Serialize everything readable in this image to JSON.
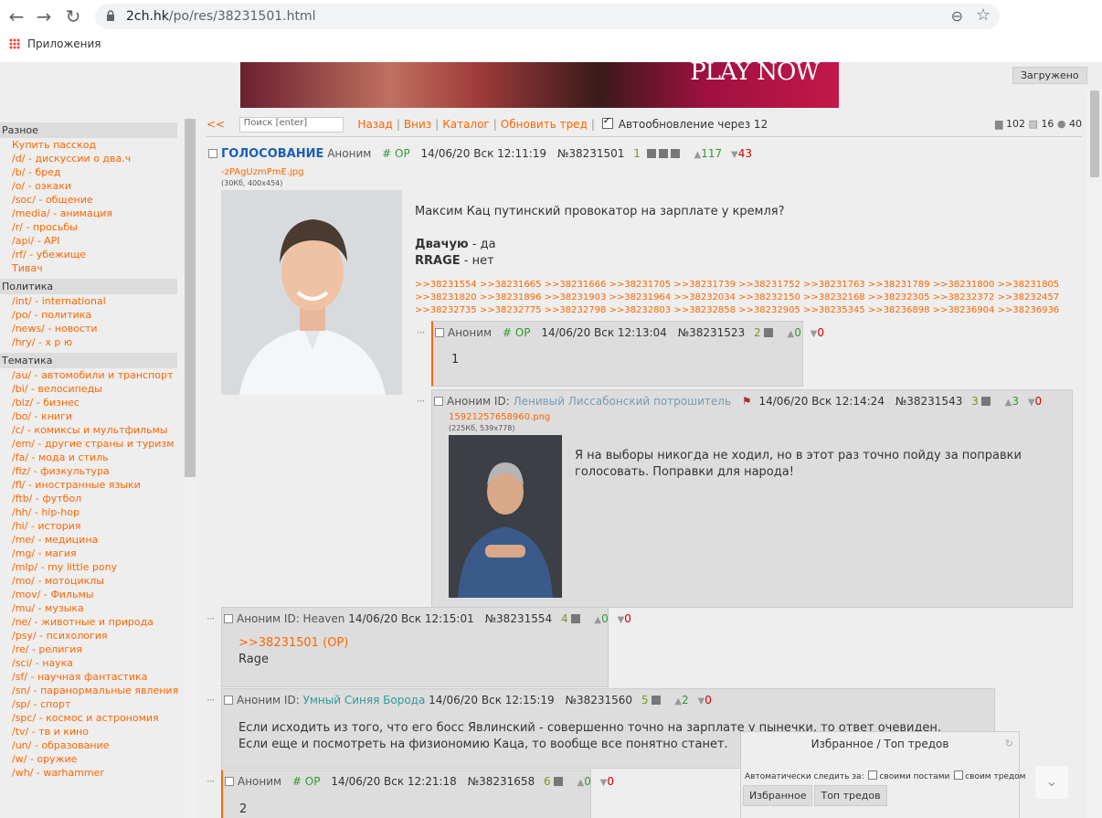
{
  "browser": {
    "url_host": "2ch.hk",
    "url_path": "/po/res/38231501.html",
    "bookmarks_label": "Приложения"
  },
  "page": {
    "banner_text": "PLAY NOW",
    "loaded_label": "Загружено"
  },
  "menu": {
    "sections": [
      {
        "title": "Разное",
        "items": [
          "Купить пасскод",
          "/d/  - дискуссии о два.ч",
          "/b/  - бред",
          "/o/  - оэкаки",
          "/soc/  - общение",
          "/media/  - анимация",
          "/r/  - просьбы",
          "/api/  - API",
          "/rf/  - убежище",
          "Тивач"
        ]
      },
      {
        "title": "Политика",
        "items": [
          "/int/  - international",
          "/po/  - политика",
          "/news/  - новости",
          "/hry/  - х р ю"
        ]
      },
      {
        "title": "Тематика",
        "items": [
          "/au/  - автомобили и транспорт",
          "/bi/  - велосипеды",
          "/biz/  - бизнес",
          "/bo/  - книги",
          "/c/  - комиксы и мультфильмы",
          "/em/  - другие страны и туризм",
          "/fa/  - мода и стиль",
          "/fiz/  - физкультура",
          "/fl/  - иностранные языки",
          "/ftb/  - футбол",
          "/hh/  - hip-hop",
          "/hi/  - история",
          "/me/  - медицина",
          "/mg/  - магия",
          "/mlp/  - my little pony",
          "/mo/  - мотоциклы",
          "/mov/  - Фильмы",
          "/mu/  - музыка",
          "/ne/  - животные и природа",
          "/psy/  - психология",
          "/re/  - религия",
          "/sci/  - наука",
          "/sf/  - научная фантастика",
          "/sn/  - паранормальные явления",
          "/sp/  - спорт",
          "/spc/  - космос и астрономия",
          "/tv/  - тв и кино",
          "/un/  - образование",
          "/w/  - оружие",
          "/wh/  - warhammer"
        ]
      }
    ]
  },
  "topbar": {
    "back": "<<",
    "search_placeholder": "Поиск [enter]",
    "nav_back": "Назад",
    "nav_down": "Вниз",
    "catalog": "Каталог",
    "refresh": "Обновить тред",
    "autoupdate": "Автообновление через 12",
    "stat_posts": "102",
    "stat_images": "16",
    "stat_users": "40"
  },
  "op": {
    "subject": "ГОЛОСОВАНИЕ",
    "name": "Аноним",
    "op_tag": "# OP",
    "date": "14/06/20 Вск 12:11:19",
    "num": "№38231501",
    "count": "1",
    "likes": "117",
    "dislikes": "43",
    "file_name": "-zPAgUzmPmE.jpg",
    "file_meta": "(30Кб, 400x454)",
    "text1": "Максим Кац путинский провокатор на зарплате у кремля?",
    "bold1": "Двачую",
    "text2": " - да",
    "bold2": "RRAGE",
    "text3": " - нет",
    "replies": ">>38231554 >>38231665 >>38231666 >>38231705 >>38231739 >>38231752 >>38231763 >>38231789 >>38231800 >>38231805 >>38231820 >>38231896 >>38231903 >>38231964 >>38232034 >>38232150 >>38232168 >>38232305 >>38232372 >>38232457 >>38232735 >>38232775 >>38232798 >>38232803 >>38232858 >>38232905 >>38235345 >>38236898 >>38236904 >>38236936"
  },
  "posts": [
    {
      "name": "Аноним",
      "op_tag": "# OP",
      "date": "14/06/20 Вск 12:13:04",
      "num": "№38231523",
      "count": "2",
      "likes": "0",
      "dislikes": "0",
      "text": "1"
    },
    {
      "name": "Аноним ID:",
      "id_name": "Ленивый Лиссабонский потрошитель",
      "date": "14/06/20 Вск 12:14:24",
      "num": "№38231543",
      "count": "3",
      "likes": "3",
      "dislikes": "0",
      "file_name": "15921257658960.png",
      "file_meta": "(225Кб, 539x778)",
      "text": "Я на выборы никогда не ходил, но в этот раз точно пойду за поправки голосовать. Поправки для народа!"
    },
    {
      "name": "Аноним ID: Heaven",
      "date": "14/06/20 Вск 12:15:01",
      "num": "№38231554",
      "count": "4",
      "likes": "0",
      "dislikes": "0",
      "reply_link": ">>38231501 (OP)",
      "text": "Rage"
    },
    {
      "name": "Аноним ID:",
      "id_name": "Умный Синяя Борода",
      "date": "14/06/20 Вск 12:15:19",
      "num": "№38231560",
      "count": "5",
      "likes": "2",
      "dislikes": "0",
      "text": "Если исходить из того, что его босс Явлинский - совершенно точно на зарплате у пынечки, то ответ очевиден. Если еще и посмотреть на физиономию Каца, то вообще все понятно станет."
    },
    {
      "name": "Аноним",
      "op_tag": "# OP",
      "date": "14/06/20 Вск 12:21:18",
      "num": "№38231658",
      "count": "6",
      "likes": "0",
      "dislikes": "0",
      "text": "2"
    }
  ],
  "favorites": {
    "title": "Избранное / Топ тредов",
    "auto_label": "Автоматически следить за:",
    "opt_own_posts": "своими постами",
    "opt_own_thread": "своим тредом",
    "tab_fav": "Избранное",
    "tab_top": "Топ тредов"
  }
}
